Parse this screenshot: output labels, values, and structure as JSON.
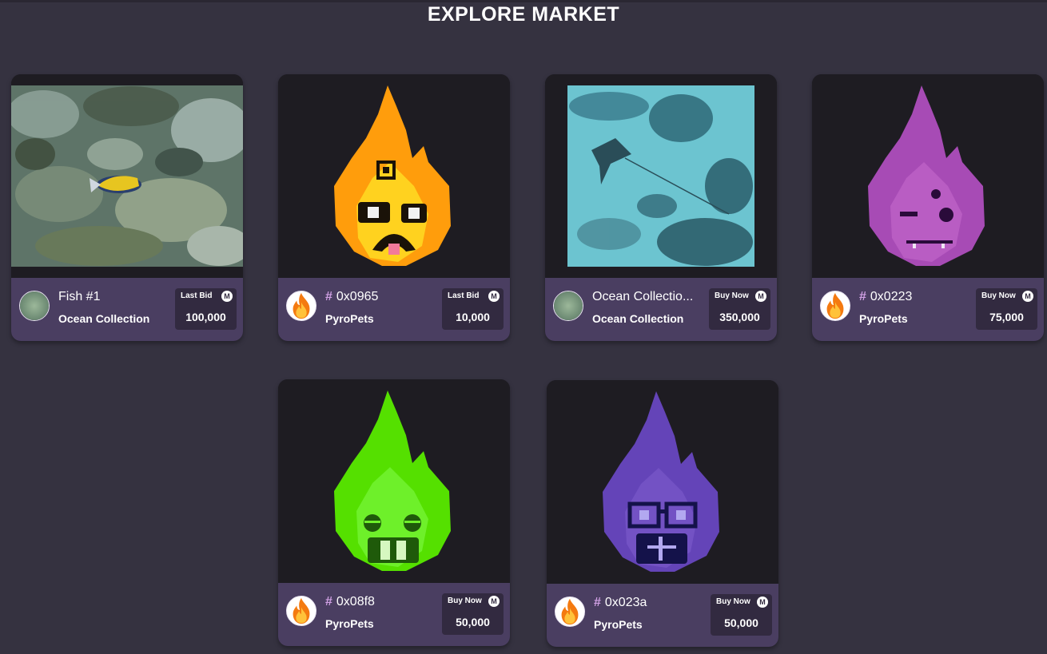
{
  "page": {
    "title": "EXPLORE MARKET"
  },
  "colors": {
    "background": "#353240",
    "card_footer": "#4a3e61",
    "price_box": "#322a40",
    "hash": "#d0a0e4"
  },
  "cards": [
    {
      "name": "Fish #1",
      "collection": "Ocean Collection",
      "price_label": "Last Bid",
      "price": "100,000",
      "avatar_icon": "ocean-avatar",
      "image": "coral-reef-fish"
    },
    {
      "name": "0x0965",
      "hash": "#",
      "collection": "PyroPets",
      "price_label": "Last Bid",
      "price": "10,000",
      "avatar_icon": "fire-icon",
      "image": "orange-pyropet"
    },
    {
      "name": "Ocean Collectio...",
      "collection": "Ocean Collection",
      "price_label": "Buy Now",
      "price": "350,000",
      "avatar_icon": "ocean-avatar",
      "image": "stingray-underwater"
    },
    {
      "name": "0x0223",
      "hash": "#",
      "collection": "PyroPets",
      "price_label": "Buy Now",
      "price": "75,000",
      "avatar_icon": "fire-icon",
      "image": "purple-pyropet"
    },
    {
      "name": "0x08f8",
      "hash": "#",
      "collection": "PyroPets",
      "price_label": "Buy Now",
      "price": "50,000",
      "avatar_icon": "fire-icon",
      "image": "green-pyropet"
    },
    {
      "name": "0x023a",
      "hash": "#",
      "collection": "PyroPets",
      "price_label": "Buy Now",
      "price": "50,000",
      "avatar_icon": "fire-icon",
      "image": "violet-pyropet"
    }
  ],
  "currency_icon": "M"
}
